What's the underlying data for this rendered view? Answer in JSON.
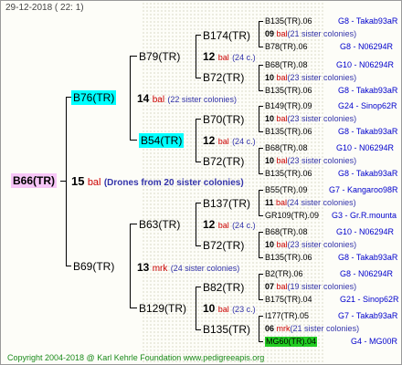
{
  "header": "29-12-2018 ( 22: 1)",
  "footer": "Copyright 2004-2018 @ Karl Kehrle Foundation    www.pedigreeapis.org",
  "root": {
    "label": "B66(TR)",
    "num": "15",
    "tag": "bal",
    "note": "(Drones from 20 sister colonies)"
  },
  "gen1": [
    {
      "label": "B76(TR)",
      "num": "14",
      "tag": "bal",
      "note": "(22 sister colonies)"
    },
    {
      "label": "B69(TR)",
      "num": "13",
      "tag": "mrk",
      "note": "(24 sister colonies)"
    }
  ],
  "gen2": [
    {
      "label": "B79(TR)"
    },
    {
      "label": "B54(TR)",
      "num": "12",
      "tag": "bal",
      "note": "(24 c.)"
    },
    {
      "label": "B63(TR)",
      "num": "12",
      "tag": "bal",
      "note": "(24 c.)"
    },
    {
      "label": "B129(TR)",
      "num": "10",
      "tag": "bal",
      "note": "(23 c.)"
    }
  ],
  "gen3": [
    {
      "label": "B174(TR)",
      "num": "12",
      "tag": "bal",
      "note": "(24 c.)"
    },
    {
      "label": "B72(TR)"
    },
    {
      "label": "B70(TR)",
      "num": "12",
      "tag": "bal",
      "note": "(24 c.)"
    },
    {
      "label": "B72(TR)"
    },
    {
      "label": "B137(TR)",
      "num": "12",
      "tag": "bal",
      "note": "(24 c.)"
    },
    {
      "label": "B72(TR)"
    },
    {
      "label": "B82(TR)",
      "num": "10",
      "tag": "bal",
      "note": "(23 c.)"
    },
    {
      "label": "B135(TR)"
    }
  ],
  "leaves": [
    {
      "text": "B135(TR).06",
      "ped": "G8 - Takab93aR"
    },
    {
      "num": "09",
      "tag": "bal",
      "note": "(21 sister colonies)"
    },
    {
      "text": "B78(TR).06",
      "ped": "G8 - N06294R"
    },
    {
      "text": "B68(TR).08",
      "ped": "G10 - N06294R"
    },
    {
      "num": "10",
      "tag": "bal",
      "note": "(23 sister colonies)"
    },
    {
      "text": "B135(TR).06",
      "ped": "G8 - Takab93aR"
    },
    {
      "text": "B149(TR).09",
      "ped": "G24 - Sinop62R"
    },
    {
      "num": "10",
      "tag": "bal",
      "note": "(23 sister colonies)"
    },
    {
      "text": "B135(TR).06",
      "ped": "G8 - Takab93aR"
    },
    {
      "text": "B68(TR).08",
      "ped": "G10 - N06294R"
    },
    {
      "num": "10",
      "tag": "bal",
      "note": "(23 sister colonies)"
    },
    {
      "text": "B135(TR).06",
      "ped": "G8 - Takab93aR"
    },
    {
      "text": "B55(TR).09",
      "ped": "G7 - Kangaroo98R"
    },
    {
      "num": "11",
      "tag": "bal",
      "note": "(24 sister colonies)"
    },
    {
      "text": "GR109(TR).09",
      "ped": "G3 - Gr.R.mounta"
    },
    {
      "text": "B68(TR).08",
      "ped": "G10 - N06294R"
    },
    {
      "num": "10",
      "tag": "bal",
      "note": "(23 sister colonies)"
    },
    {
      "text": "B135(TR).06",
      "ped": "G8 - Takab93aR"
    },
    {
      "text": "B2(TR).06",
      "ped": "G8 - N06294R"
    },
    {
      "num": "07",
      "tag": "bal",
      "note": "(19 sister colonies)"
    },
    {
      "text": "B175(TR).04",
      "ped": "G21 - Sinop62R"
    },
    {
      "text": "I177(TR).05",
      "ped": "G7 - Takab93aR"
    },
    {
      "num": "06",
      "tag": "mrk",
      "note": "(21 sister colonies)"
    },
    {
      "text": "MG60(TR).04",
      "ped": "G4 - MG00R"
    }
  ]
}
